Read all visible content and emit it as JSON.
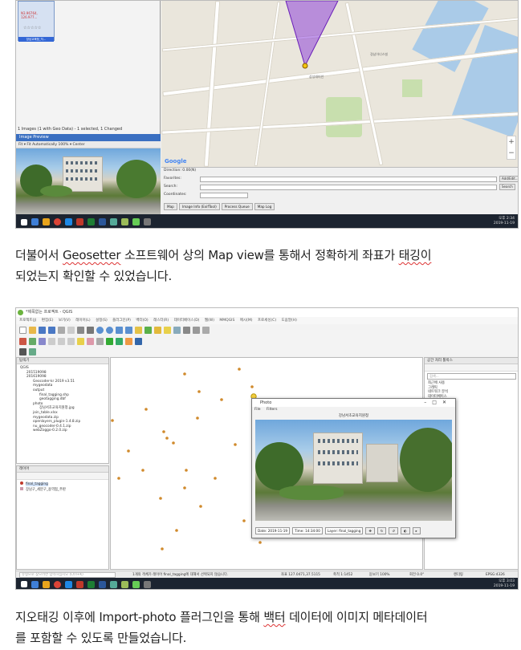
{
  "geosetter": {
    "thumb_red_text": "N3.96764, 126.977...",
    "thumb_stars": "☆☆☆☆☆",
    "thumb_label": "장남교육청_직...",
    "status_text": "1 Images (1 with Geo Data) - 1 selected, 1 Changed",
    "image_preview_title": "Image Preview",
    "preview_toolbar": "Fit  ▾  Fit Automatically  100% ▾  Center",
    "direction_text": "Direction: 0.00(N)",
    "form_labels": [
      "Favorites:",
      "Search:",
      "Coordinates:"
    ],
    "form_buttons": [
      "Add/Edit...",
      "Search"
    ],
    "tabs": [
      "Map",
      "Image Info (ExifTool)",
      "Process Queue",
      "Map Log"
    ],
    "map_labels": [
      "삼성래미안",
      "경남아너스빌",
      "Google"
    ],
    "zoom": [
      "+",
      "−"
    ],
    "taskbar_time": "오후 2:34",
    "taskbar_date": "2019-11-19"
  },
  "paragraph1": {
    "line1_parts": [
      "더불어서 ",
      "Geosetter",
      " 소프트웨어 상의 Map view를 통해서 정확하게 좌표가 ",
      "태깅이"
    ],
    "line2": "되었는지 확인할 수 있었습니다."
  },
  "qgis": {
    "window_title": "*제목없는 프로젝트 - QGIS",
    "menu": "프로젝트(J)  편집(E)  보기(V)  레이어(L)  설정(S)  플러그인(P)  벡터(O)  래스터(R)  데이터베이스(D)  웹(W)  MMQGIS  메시(M)  프로세싱(C)  도움말(H)",
    "browser_title": "탐색기",
    "browser_items": [
      "QGIS",
      "201519098",
      "201619098",
      "Geocoder-kr 2019 v3.51",
      "mygeodata",
      "output",
      "final_tagging.shp",
      "geotagging.dbf",
      "photo",
      "장남서초교육지원청.jpg",
      "join_table.xlsx",
      "mygeodata.zip",
      "openlayers_plugin-1.4.8.zip",
      "nu_geocoder-0.4.1.zip",
      "webZoggo-0.2.0.zip"
    ],
    "layers_title": "레이어",
    "layer_items": [
      "final_tagging",
      "장남구_세분구_용역협_주판"
    ],
    "processing_title": "공간 처리 툴박스",
    "processing_search": "검색...",
    "processing_items": [
      "최근에 사용",
      "그래픽",
      "네트워크 분석",
      "데이터베이스",
      "벡터 분석",
      "벡터 생성",
      "벡터 선택",
      "벡터 일반",
      "벡터 지오메트리",
      "벡터 테이블"
    ],
    "photo_window": {
      "title": "Photo",
      "menu": [
        "File",
        "Filters"
      ],
      "caption": "강남서초교육지원청",
      "date": "Date: 2019-11-19",
      "time": "Time: 14:34:00",
      "layer": "Layer: final_tagging",
      "controls": [
        "✥",
        "↻",
        "↺",
        "◐",
        "▸"
      ]
    },
    "status": {
      "search_placeholder": "유형으로 찾으려면 입력하십시오 (Ctrl+K)",
      "message": "1개의 객체가 레이어 final_tagging에 대해서 선택되지 않습니다.",
      "coord": "좌표 127.0471,37.5115",
      "scale": "축척 1:1452",
      "magnifier": "돋보기 100%",
      "rotation": "회전 0.0°",
      "render": "렌더링",
      "crs": "EPSG:4326"
    },
    "taskbar_time": "오후 3:03",
    "taskbar_date": "2019-11-19"
  },
  "paragraph2": {
    "line1_parts": [
      "지오태깅 이후에 Import-photo 플러그인을 통해 ",
      "백터",
      " 데이터에 이미지 메타데이터"
    ],
    "line2": "를 포함할 수 있도록 만들었습니다."
  },
  "colors": {
    "sector": "#8e44d9",
    "qgis_point": "#d08a2c",
    "taskbar": "#1c2430",
    "spell_underline": "#dd3333"
  }
}
